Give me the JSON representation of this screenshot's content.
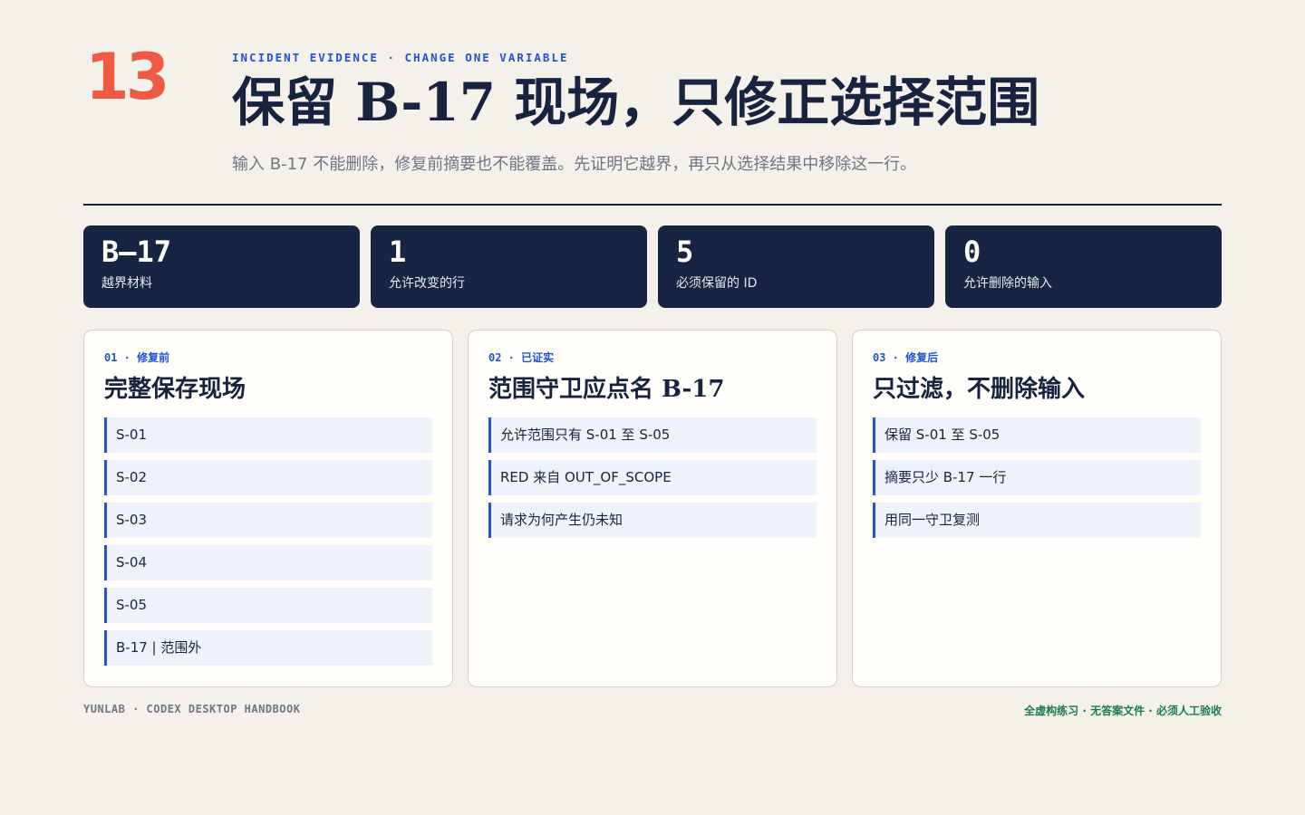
{
  "page_number": "13",
  "header": {
    "eyebrow": "INCIDENT EVIDENCE · CHANGE ONE VARIABLE",
    "title": "保留 B-17 现场，只修正选择范围",
    "subtitle": "输入 B-17 不能删除，修复前摘要也不能覆盖。先证明它越界，再只从选择结果中移除这一行。"
  },
  "stats": [
    {
      "value": "B–17",
      "label": "越界材料"
    },
    {
      "value": "1",
      "label": "允许改变的行"
    },
    {
      "value": "5",
      "label": "必须保留的 ID"
    },
    {
      "value": "0",
      "label": "允许删除的输入"
    }
  ],
  "cards": [
    {
      "tag": "01 · 修复前",
      "title": "完整保存现场",
      "items": [
        "S-01",
        "S-02",
        "S-03",
        "S-04",
        "S-05",
        "B-17 | 范围外"
      ]
    },
    {
      "tag": "02 · 已证实",
      "title": "范围守卫应点名 B-17",
      "items": [
        "允许范围只有 S-01 至 S-05",
        "RED 来自 OUT_OF_SCOPE",
        "请求为何产生仍未知"
      ]
    },
    {
      "tag": "03 · 修复后",
      "title": "只过滤，不删除输入",
      "items": [
        "保留 S-01 至 S-05",
        "摘要只少 B-17 一行",
        "用同一守卫复测"
      ]
    }
  ],
  "footer": {
    "left": "YUNLAB · CODEX DESKTOP HANDBOOK",
    "right": "全虚构练习 · 无答案文件 · 必须人工验收"
  },
  "colors": {
    "background": "#f4f0ea",
    "accent_number": "#ee5a44",
    "accent_blue": "#2452d6",
    "navy": "#172542",
    "footer_green": "#1d7a4d"
  }
}
